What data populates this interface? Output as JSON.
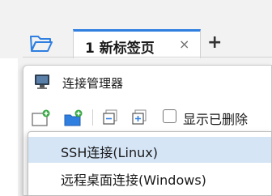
{
  "tabs": [
    {
      "label": "1 新标签页",
      "close": "×"
    }
  ],
  "new_tab": "+",
  "window": {
    "title": "连接管理器"
  },
  "toolbar": {
    "show_deleted_label": "显示已删除",
    "show_deleted_checked": false
  },
  "dropdown": {
    "items": [
      {
        "label": "SSH连接(Linux)",
        "highlighted": true
      },
      {
        "label": "远程桌面连接(Windows)",
        "highlighted": false
      }
    ]
  },
  "colors": {
    "accent": "#2f7fe0",
    "highlight": "#d5e5f6",
    "add_badge": "#3aa845"
  },
  "icons": [
    "folder-open-icon",
    "monitor-icon",
    "new-file-icon",
    "new-folder-icon",
    "collapse-icon",
    "expand-icon",
    "close-icon",
    "plus-icon"
  ]
}
